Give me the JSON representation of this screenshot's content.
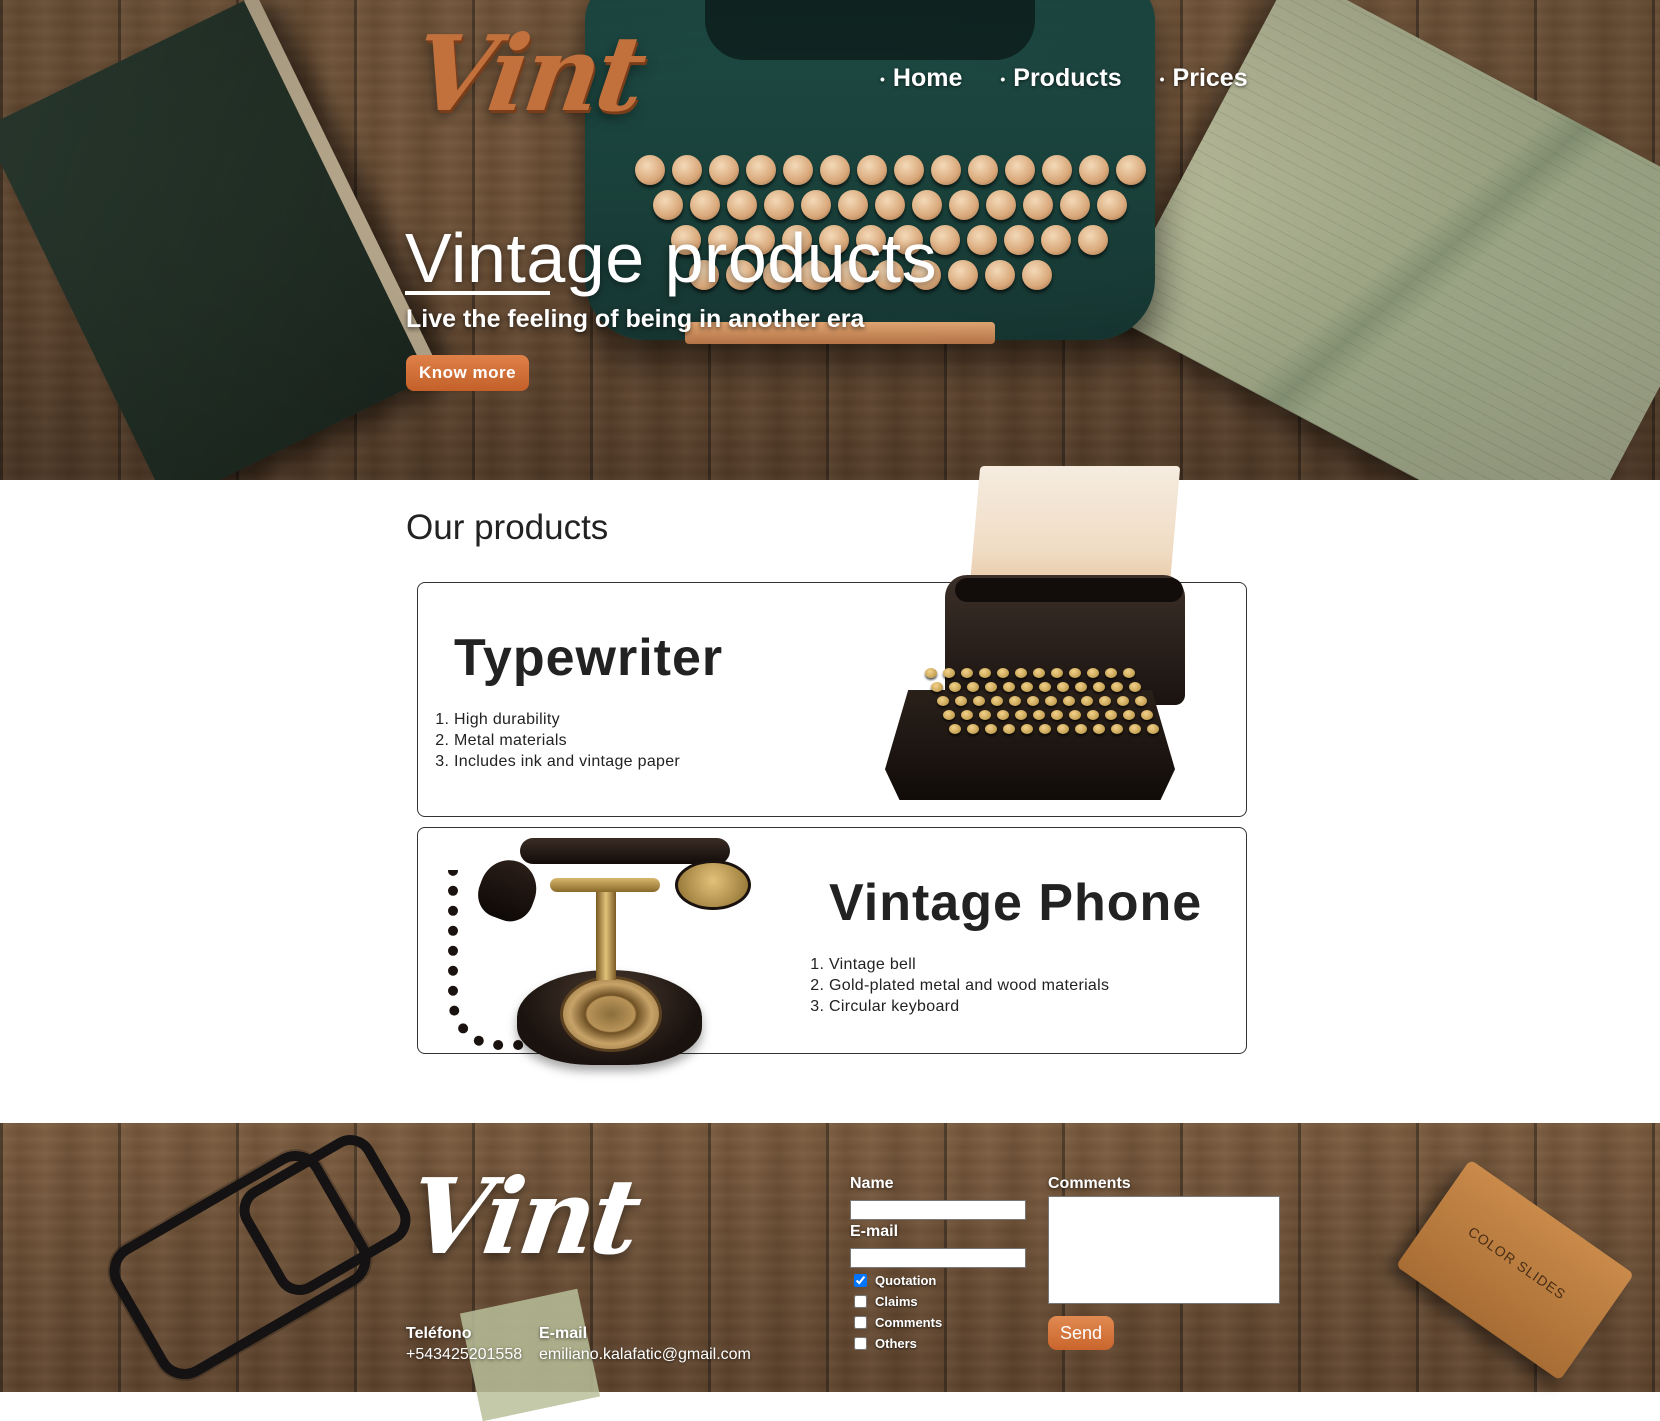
{
  "brand": {
    "logo_text": "Vint"
  },
  "nav": {
    "items": [
      {
        "label": "Home"
      },
      {
        "label": "Products"
      },
      {
        "label": "Prices"
      }
    ]
  },
  "hero": {
    "title": "Vintage products",
    "subtitle": "Live the feeling of being in another era",
    "cta_label": "Know more"
  },
  "products": {
    "heading": "Our products",
    "items": [
      {
        "name": "Typewriter",
        "features": [
          "High durability",
          "Metal materials",
          "Includes ink and vintage paper"
        ]
      },
      {
        "name": "Vintage Phone",
        "features": [
          "Vintage bell",
          "Gold-plated metal and wood materials",
          "Circular keyboard"
        ]
      }
    ]
  },
  "footer": {
    "logo_text": "Vint",
    "decor_box_text": "COLOR SLIDES",
    "contact": {
      "phone_label": "Teléfono",
      "phone_value": "+543425201558",
      "email_label": "E-mail",
      "email_value": "emiliano.kalafatic@gmail.com"
    },
    "form": {
      "name_label": "Name",
      "name_value": "",
      "email_label": "E-mail",
      "email_value": "",
      "comments_label": "Comments",
      "comments_value": "",
      "checkboxes": [
        {
          "label": "Quotation",
          "checked": true
        },
        {
          "label": "Claims",
          "checked": false
        },
        {
          "label": "Comments",
          "checked": false
        },
        {
          "label": "Others",
          "checked": false
        }
      ],
      "send_label": "Send"
    }
  },
  "colors": {
    "accent": "#c9652c",
    "logo_brown": "#c2703c",
    "typewriter_teal": "#1e4a44",
    "wood": "#6e5136"
  }
}
